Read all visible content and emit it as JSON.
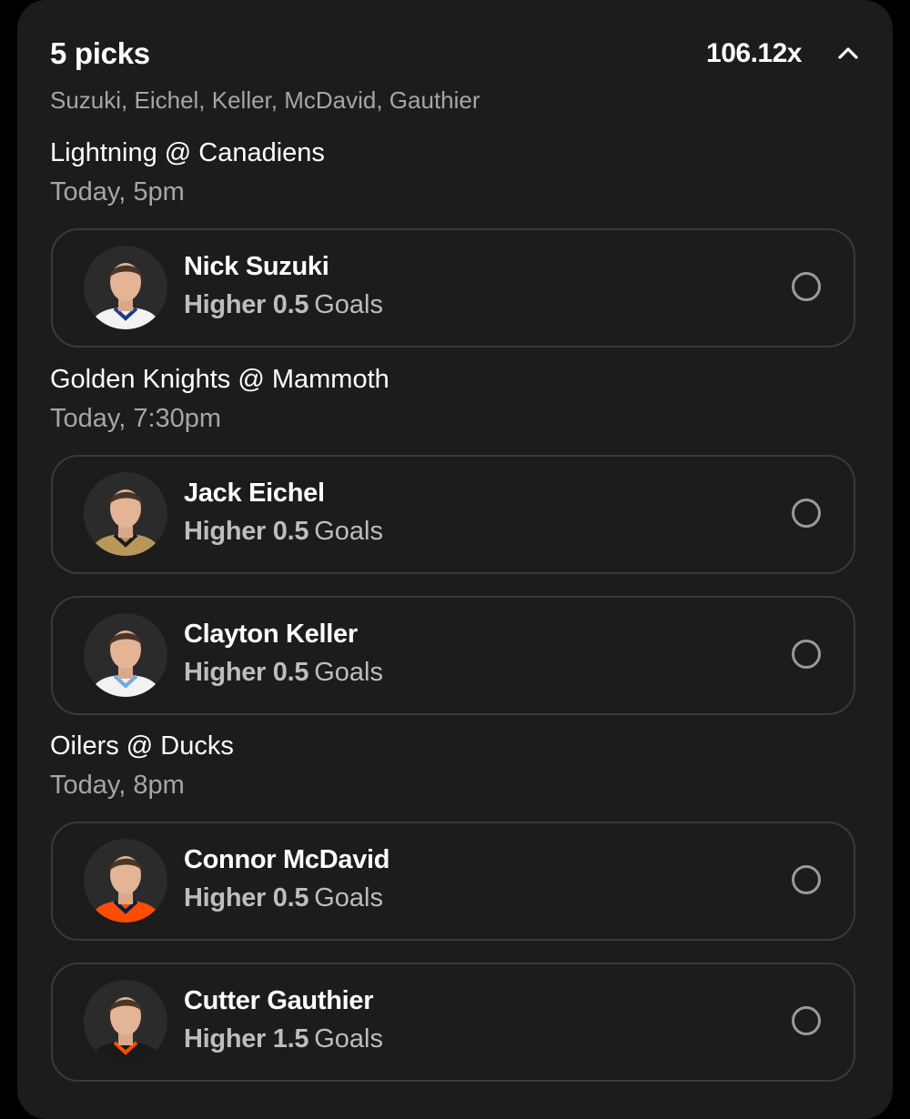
{
  "header": {
    "title": "5 picks",
    "multiplier": "106.12x",
    "player_summary": "Suzuki, Eichel, Keller, McDavid, Gauthier",
    "collapse_icon": "chevron-up-icon"
  },
  "games": [
    {
      "matchup": "Lightning @ Canadiens",
      "time": "Today, 5pm",
      "picks": [
        {
          "player": "Nick Suzuki",
          "direction": "Higher 0.5",
          "stat": "Goals",
          "jersey_color": "#f2f2f2",
          "trim_color": "#1e3a8a"
        }
      ]
    },
    {
      "matchup": "Golden Knights @ Mammoth",
      "time": "Today, 7:30pm",
      "picks": [
        {
          "player": "Jack Eichel",
          "direction": "Higher 0.5",
          "stat": "Goals",
          "jersey_color": "#b8975a",
          "trim_color": "#1a1a1a"
        },
        {
          "player": "Clayton Keller",
          "direction": "Higher 0.5",
          "stat": "Goals",
          "jersey_color": "#f2f2f2",
          "trim_color": "#6cace4"
        }
      ]
    },
    {
      "matchup": "Oilers @ Ducks",
      "time": "Today, 8pm",
      "picks": [
        {
          "player": "Connor McDavid",
          "direction": "Higher 0.5",
          "stat": "Goals",
          "jersey_color": "#fc4c02",
          "trim_color": "#041e42"
        },
        {
          "player": "Cutter Gauthier",
          "direction": "Higher 1.5",
          "stat": "Goals",
          "jersey_color": "#1a1a1a",
          "trim_color": "#fc4c02"
        }
      ]
    }
  ],
  "colors": {
    "panel_bg": "#1c1c1c",
    "card_border": "#3a3a3a",
    "muted_text": "#a6a6a6"
  }
}
